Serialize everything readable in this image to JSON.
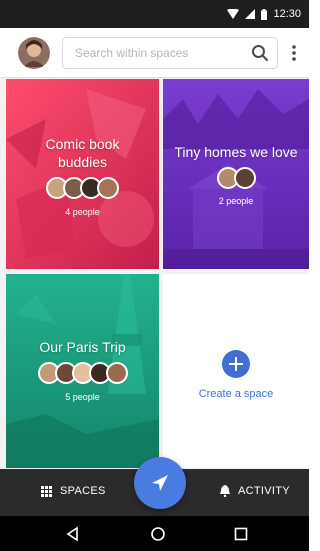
{
  "status_bar": {
    "time": "12:30",
    "icons": [
      "wifi-icon",
      "signal-icon",
      "battery-icon"
    ]
  },
  "app_bar": {
    "avatar_icon": "user-avatar",
    "search_placeholder": "Search within spaces",
    "search_icon": "search-icon",
    "menu_icon": "more-vert-icon"
  },
  "spaces": [
    {
      "title_line1": "Comic book",
      "title_line2": "buddies",
      "count": "4 people",
      "color": "#e8345a",
      "avatars": 4
    },
    {
      "title_line1": "Tiny homes we love",
      "count": "2 people",
      "color": "#6a2fbf",
      "avatars": 2
    },
    {
      "title_line1": "Our Paris Trip",
      "count": "5 people",
      "color": "#1a9e7f",
      "avatars": 5
    }
  ],
  "create_space": {
    "label": "Create a space",
    "icon": "plus-icon",
    "color": "#3f6fd6"
  },
  "bottom_nav": {
    "spaces_label": "SPACES",
    "spaces_icon": "grid-icon",
    "activity_label": "ACTIVITY",
    "activity_icon": "bell-icon",
    "fab_icon": "send-icon",
    "fab_color": "#4a7be0"
  },
  "system_nav": {
    "icons": [
      "back-icon",
      "home-icon",
      "recents-icon"
    ]
  }
}
